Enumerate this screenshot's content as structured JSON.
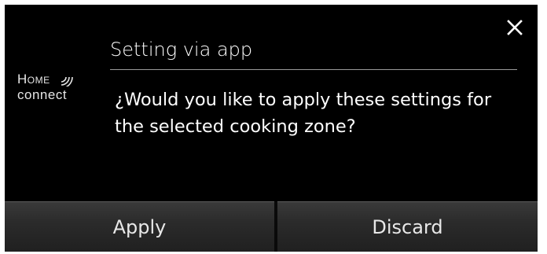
{
  "dialog": {
    "title": "Setting via app",
    "message": "¿Would you like to apply these settings for the selected cooking zone?",
    "close_icon": "close-icon"
  },
  "logo": {
    "line1": "Home",
    "line2": "connect",
    "icon": "wifi-signal-icon"
  },
  "buttons": {
    "apply_label": "Apply",
    "discard_label": "Discard"
  },
  "colors": {
    "background": "#000000",
    "text": "#ffffff",
    "button_bg": "#2b2b2b",
    "divider": "#9a9a9a"
  }
}
